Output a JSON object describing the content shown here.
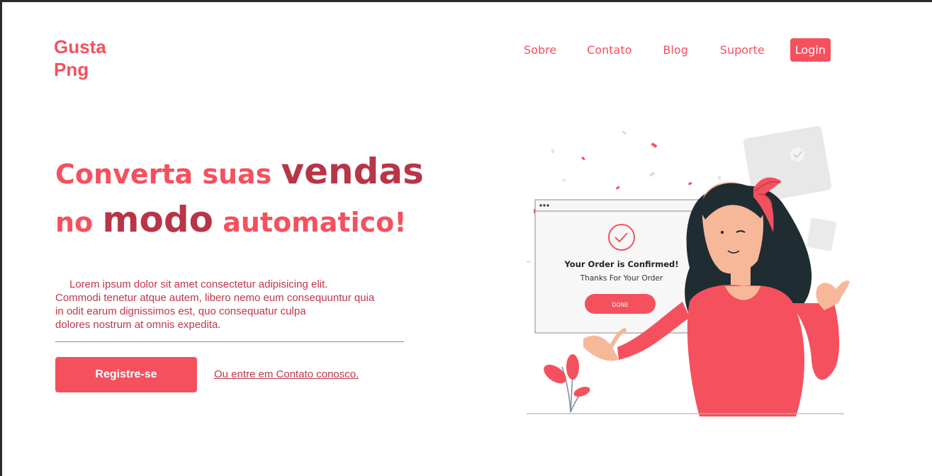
{
  "brand": {
    "line1": "Gusta",
    "line2": "Png"
  },
  "nav": {
    "items": [
      {
        "label": "Sobre"
      },
      {
        "label": "Contato"
      },
      {
        "label": "Blog"
      },
      {
        "label": "Suporte"
      }
    ],
    "login_label": "Login"
  },
  "hero": {
    "part1": "Converta suas ",
    "part2": "vendas",
    "part3": "no ",
    "part4": "modo",
    "part5": " automatico!"
  },
  "description": {
    "line1": "Lorem ipsum dolor sit amet consectetur adipisicing elit.",
    "line2": "Commodi tenetur atque autem, libero nemo eum consequuntur quia",
    "line3": "in odit earum dignissimos est, quo consequatur culpa",
    "line4": "dolores nostrum at omnis expedita."
  },
  "cta": {
    "register_label": "Registre-se",
    "contact_text": "Ou entre em Contato conosco."
  },
  "illustration": {
    "card_title": "Your Order is Confirmed!",
    "card_subtitle": "Thanks For Your Order",
    "card_button": "DONE"
  },
  "colors": {
    "accent": "#f5505e",
    "dark_accent": "#b83547",
    "hair": "#1f2d33",
    "skin": "#f7b89a"
  }
}
